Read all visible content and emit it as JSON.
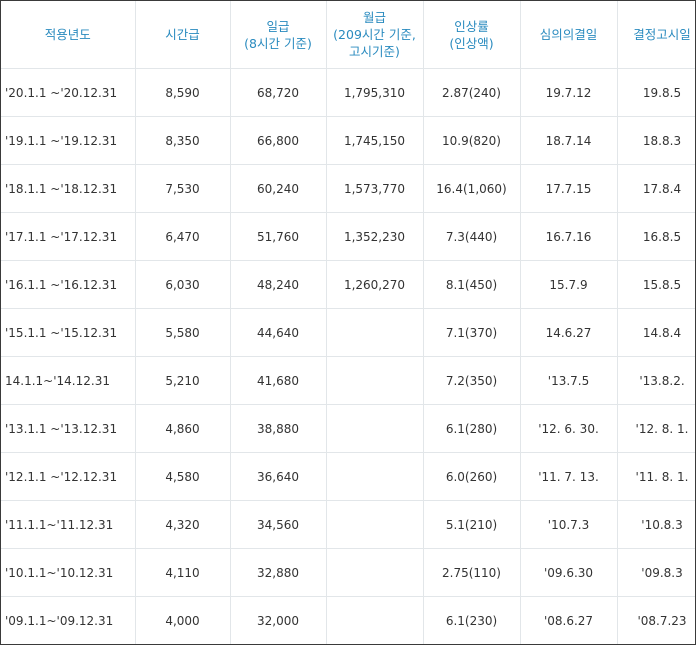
{
  "headers": [
    {
      "lines": [
        "적용년도"
      ]
    },
    {
      "lines": [
        "시간급"
      ]
    },
    {
      "lines": [
        "일급",
        "(8시간 기준)"
      ]
    },
    {
      "lines": [
        "월급",
        "(209시간 기준,",
        "고시기준)"
      ]
    },
    {
      "lines": [
        "인상률",
        "(인상액)"
      ]
    },
    {
      "lines": [
        "심의의결일"
      ]
    },
    {
      "lines": [
        "결정고시일"
      ]
    }
  ],
  "rows": [
    {
      "period": "'20.1.1 ~'20.12.31",
      "hourly": "8,590",
      "daily": "68,720",
      "monthly": "1,795,310",
      "rate": "2.87(240)",
      "resolution": "19.7.12",
      "notice": "19.8.5"
    },
    {
      "period": "'19.1.1 ~'19.12.31",
      "hourly": "8,350",
      "daily": "66,800",
      "monthly": "1,745,150",
      "rate": "10.9(820)",
      "resolution": "18.7.14",
      "notice": "18.8.3"
    },
    {
      "period": "'18.1.1 ~'18.12.31",
      "hourly": "7,530",
      "daily": "60,240",
      "monthly": "1,573,770",
      "rate": "16.4(1,060)",
      "resolution": "17.7.15",
      "notice": "17.8.4"
    },
    {
      "period": "'17.1.1 ~'17.12.31",
      "hourly": "6,470",
      "daily": "51,760",
      "monthly": "1,352,230",
      "rate": "7.3(440)",
      "resolution": "16.7.16",
      "notice": "16.8.5"
    },
    {
      "period": "'16.1.1 ~'16.12.31",
      "hourly": "6,030",
      "daily": "48,240",
      "monthly": "1,260,270",
      "rate": "8.1(450)",
      "resolution": "15.7.9",
      "notice": "15.8.5"
    },
    {
      "period": "'15.1.1 ~'15.12.31",
      "hourly": "5,580",
      "daily": "44,640",
      "monthly": "",
      "rate": "7.1(370)",
      "resolution": "14.6.27",
      "notice": "14.8.4"
    },
    {
      "period": " 14.1.1~'14.12.31",
      "hourly": "5,210",
      "daily": "41,680",
      "monthly": "",
      "rate": "7.2(350)",
      "resolution": "'13.7.5",
      "notice": "'13.8.2."
    },
    {
      "period": "'13.1.1 ~'13.12.31",
      "hourly": "4,860",
      "daily": "38,880",
      "monthly": "",
      "rate": "6.1(280)",
      "resolution": "'12. 6. 30.",
      "notice": "'12. 8. 1."
    },
    {
      "period": "'12.1.1 ~'12.12.31",
      "hourly": "4,580",
      "daily": "36,640",
      "monthly": "",
      "rate": "6.0(260)",
      "resolution": "'11. 7. 13.",
      "notice": "'11. 8. 1."
    },
    {
      "period": " '11.1.1~'11.12.31",
      "hourly": "4,320",
      "daily": "34,560",
      "monthly": "",
      "rate": "5.1(210)",
      "resolution": "'10.7.3",
      "notice": "'10.8.3"
    },
    {
      "period": " '10.1.1~'10.12.31",
      "hourly": "4,110",
      "daily": "32,880",
      "monthly": "",
      "rate": "2.75(110)",
      "resolution": "'09.6.30",
      "notice": "'09.8.3"
    },
    {
      "period": " '09.1.1~'09.12.31",
      "hourly": "4,000",
      "daily": "32,000",
      "monthly": "",
      "rate": "6.1(230)",
      "resolution": "'08.6.27",
      "notice": "'08.7.23"
    }
  ],
  "colors": {
    "header_text": "#2a8bbf",
    "body_text": "#333333",
    "grid_line": "#e2e6e9",
    "frame": "#3a3a3a"
  }
}
